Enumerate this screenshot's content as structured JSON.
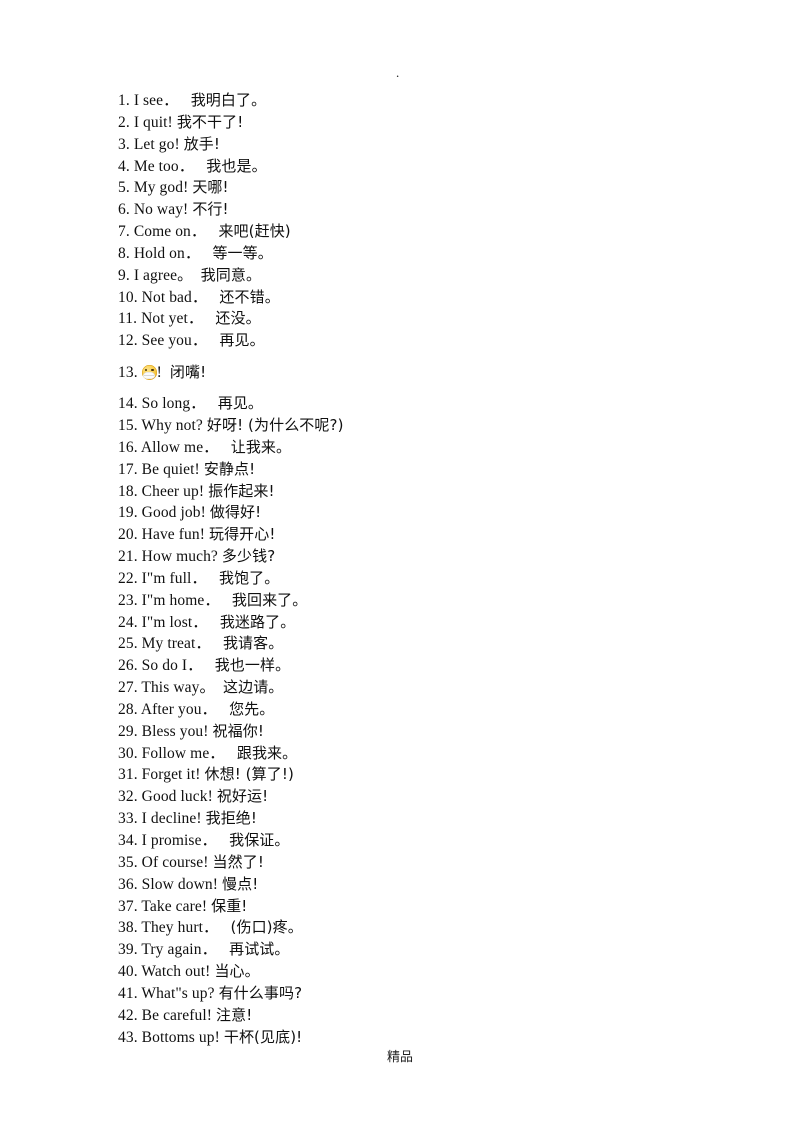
{
  "page": {
    "top_mark": ".",
    "footer": "精品"
  },
  "lines": [
    {
      "num": "1.",
      "en": "I see．",
      "gap": "   ",
      "zh": "我明白了。"
    },
    {
      "num": "2.",
      "en": "I quit!",
      "gap": " ",
      "zh": "我不干了!"
    },
    {
      "num": "3.",
      "en": "Let go!",
      "gap": " ",
      "zh": "放手!"
    },
    {
      "num": "4.",
      "en": "Me too．",
      "gap": "   ",
      "zh": "我也是。"
    },
    {
      "num": "5.",
      "en": "My god!",
      "gap": " ",
      "zh": "天哪!"
    },
    {
      "num": "6.",
      "en": "No way!",
      "gap": " ",
      "zh": "不行!"
    },
    {
      "num": "7.",
      "en": "Come on．",
      "gap": "   ",
      "zh": "来吧(赶快)"
    },
    {
      "num": "8.",
      "en": "Hold on．",
      "gap": "   ",
      "zh": "等一等。"
    },
    {
      "num": "9.",
      "en": "I agree。",
      "gap": "  ",
      "zh": "我同意。"
    },
    {
      "num": "10.",
      "en": "Not bad．",
      "gap": "   ",
      "zh": "还不错。"
    },
    {
      "num": "11.",
      "en": "Not yet．",
      "gap": "   ",
      "zh": "还没。"
    },
    {
      "num": "12.",
      "en": "See you．",
      "gap": "   ",
      "zh": "再见。"
    },
    {
      "num": "13.",
      "emoji": "shushing-face-emoji",
      "en": "!",
      "gap": "  ",
      "zh": "闭嘴!"
    },
    {
      "num": "14.",
      "en": "So long．",
      "gap": "   ",
      "zh": "再见。"
    },
    {
      "num": "15.",
      "en": "Why not?",
      "gap": " ",
      "zh": "好呀! (为什么不呢?)"
    },
    {
      "num": "16.",
      "en": "Allow me．",
      "gap": "   ",
      "zh": "让我来。"
    },
    {
      "num": "17.",
      "en": "Be quiet!",
      "gap": " ",
      "zh": "安静点!"
    },
    {
      "num": "18.",
      "en": "Cheer up!",
      "gap": " ",
      "zh": "振作起来!"
    },
    {
      "num": "19.",
      "en": "Good job!",
      "gap": " ",
      "zh": "做得好!"
    },
    {
      "num": "20.",
      "en": "Have fun!",
      "gap": " ",
      "zh": "玩得开心!"
    },
    {
      "num": "21.",
      "en": "How much?",
      "gap": " ",
      "zh": "多少钱?"
    },
    {
      "num": "22.",
      "en": "I\"m full．",
      "gap": "   ",
      "zh": "我饱了。"
    },
    {
      "num": "23.",
      "en": "I\"m home．",
      "gap": "   ",
      "zh": "我回来了。"
    },
    {
      "num": "24.",
      "en": "I\"m lost．",
      "gap": "   ",
      "zh": "我迷路了。"
    },
    {
      "num": "25.",
      "en": "My treat．",
      "gap": "   ",
      "zh": "我请客。"
    },
    {
      "num": "26.",
      "en": "So do I．",
      "gap": "   ",
      "zh": "我也一样。"
    },
    {
      "num": "27.",
      "en": "This way。",
      "gap": "  ",
      "zh": "这边请。"
    },
    {
      "num": "28.",
      "en": "After you．",
      "gap": "   ",
      "zh": "您先。"
    },
    {
      "num": "29.",
      "en": "Bless you!",
      "gap": " ",
      "zh": "祝福你!"
    },
    {
      "num": "30.",
      "en": "Follow me．",
      "gap": "   ",
      "zh": "跟我来。"
    },
    {
      "num": "31.",
      "en": "Forget it!",
      "gap": " ",
      "zh": "休想! (算了!)"
    },
    {
      "num": "32.",
      "en": "Good luck!",
      "gap": " ",
      "zh": "祝好运!"
    },
    {
      "num": "33.",
      "en": "I decline!",
      "gap": " ",
      "zh": "我拒绝!"
    },
    {
      "num": "34.",
      "en": "I promise．",
      "gap": "   ",
      "zh": "我保证。"
    },
    {
      "num": "35.",
      "en": "Of course!",
      "gap": " ",
      "zh": "当然了!"
    },
    {
      "num": "36.",
      "en": "Slow down!",
      "gap": " ",
      "zh": "慢点!"
    },
    {
      "num": "37.",
      "en": "Take care!",
      "gap": " ",
      "zh": "保重!"
    },
    {
      "num": "38.",
      "en": "They hurt．",
      "gap": "   ",
      "zh": "(伤口)疼。"
    },
    {
      "num": "39.",
      "en": "Try again．",
      "gap": "   ",
      "zh": "再试试。"
    },
    {
      "num": "40.",
      "en": "Watch out!",
      "gap": " ",
      "zh": "当心。"
    },
    {
      "num": "41.",
      "en": "What\"s up?",
      "gap": " ",
      "zh": "有什么事吗?"
    },
    {
      "num": "42.",
      "en": "Be careful!",
      "gap": " ",
      "zh": "注意!"
    },
    {
      "num": "43.",
      "en": "Bottoms up!",
      "gap": " ",
      "zh": "干杯(见底)!"
    }
  ]
}
